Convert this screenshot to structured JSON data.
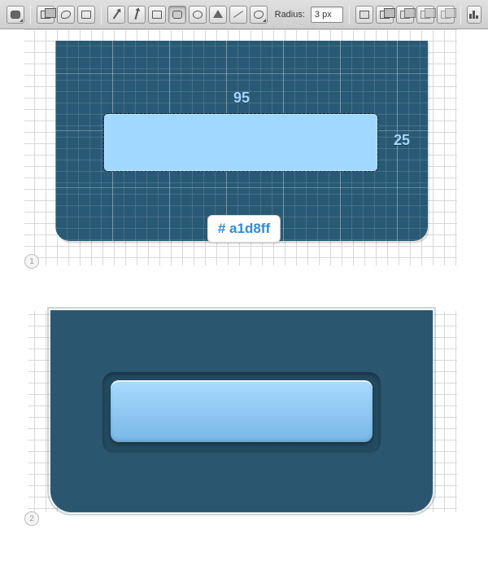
{
  "toolbar": {
    "radius_label": "Radius:",
    "radius_value": "3 px"
  },
  "step1": {
    "badge": "1",
    "dimension_width": "95",
    "dimension_height": "25",
    "color_hex": "# a1d8ff",
    "shape_color": "#a1d8ff",
    "panel_color": "#295a75"
  },
  "step2": {
    "badge": "2",
    "panel_color": "#2b566f",
    "button_gradient_top": "#a9dbff",
    "button_gradient_bottom": "#78b7e6"
  }
}
